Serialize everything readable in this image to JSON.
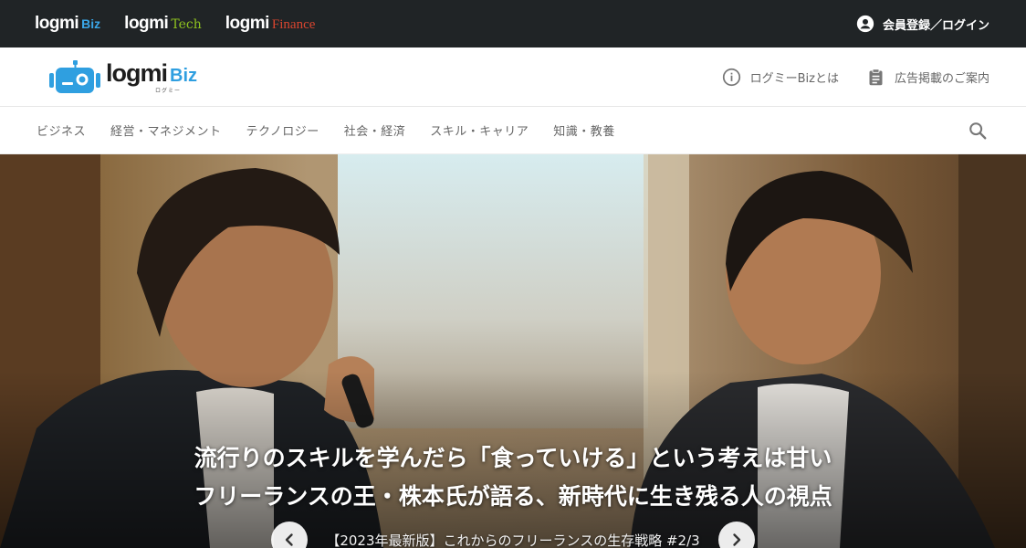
{
  "network": {
    "brands": [
      {
        "main": "logmi",
        "sub": "Biz"
      },
      {
        "main": "logmi",
        "sub": "Tech"
      },
      {
        "main": "logmi",
        "sub": "Finance"
      }
    ],
    "login_label": "会員登録／ログイン"
  },
  "header": {
    "logo_main": "logmi",
    "logo_sub": "Biz",
    "logo_kana": "ログミー",
    "links": [
      {
        "label": "ログミーBizとは",
        "icon": "info-icon"
      },
      {
        "label": "広告掲載のご案内",
        "icon": "clipboard-icon"
      }
    ]
  },
  "nav": {
    "categories": [
      "ビジネス",
      "経営・マネジメント",
      "テクノロジー",
      "社会・経済",
      "スキル・キャリア",
      "知識・教養"
    ]
  },
  "hero": {
    "title_line1": "流行りのスキルを学んだら「食っていける」という考えは甘い",
    "title_line2": "フリーランスの王・株本氏が語る、新時代に生き残る人の視点",
    "series": "【2023年最新版】これからのフリーランスの生存戦略 #2/3"
  },
  "colors": {
    "topbar": "#202426",
    "biz_accent": "#2f9fe0",
    "tech_accent": "#8fc31f",
    "finance_accent": "#d9452f"
  }
}
